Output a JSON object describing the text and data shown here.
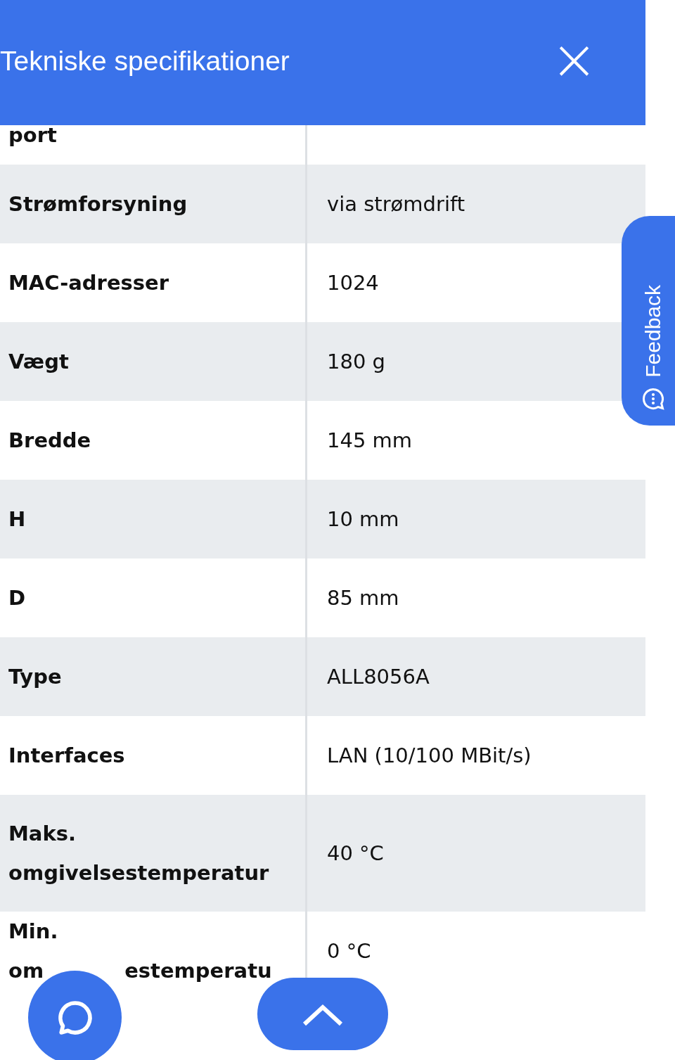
{
  "header": {
    "title": "Tekniske specifikationer",
    "close": "×"
  },
  "rows": [
    {
      "label": "port"
    },
    {
      "label": "Strømforsyning",
      "value": "via strømdrift"
    },
    {
      "label": "MAC-adresser",
      "value": "1024"
    },
    {
      "label": "Vægt",
      "value": "180 g"
    },
    {
      "label": "Bredde",
      "value": "145 mm"
    },
    {
      "label": "H",
      "value": "10 mm"
    },
    {
      "label": "D",
      "value": "85 mm"
    },
    {
      "label": "Type",
      "value": "ALL8056A"
    },
    {
      "label": "Interfaces",
      "value": "LAN (10/100 MBit/s)"
    },
    {
      "label": "Maks. omgivelsestemperatur",
      "value": "40 °C"
    },
    {
      "label": "Min.",
      "label_fragments": [
        "om",
        "estemperatu"
      ],
      "value": "0 °C"
    }
  ],
  "feedback": {
    "label": "Feedback"
  }
}
